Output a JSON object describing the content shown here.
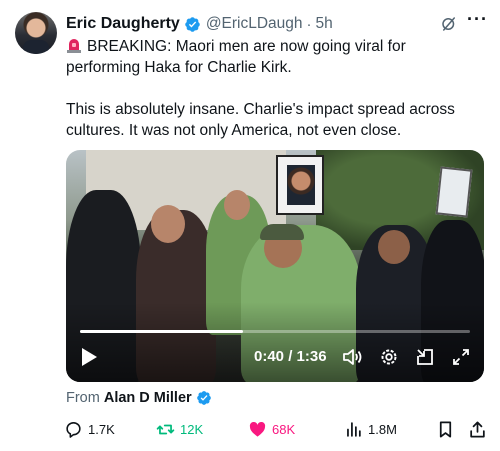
{
  "author": {
    "name": "Eric Daugherty",
    "handle": "@EricLDaugh",
    "separator": "·",
    "time": "5h"
  },
  "tweet": {
    "line1": "BREAKING: Maori men are now going viral for performing Haka for Charlie Kirk.",
    "line2": "This is absolutely insane. Charlie's impact spread across cultures. It was not only America, not even close."
  },
  "video": {
    "timecode": "0:40 / 1:36",
    "progress_fraction": 0.417
  },
  "source": {
    "prefix": "From",
    "name": "Alan D Miller"
  },
  "actions": {
    "replies": "1.7K",
    "reposts": "12K",
    "likes": "68K",
    "views": "1.8M"
  },
  "colors": {
    "verified": "#1d9bf0",
    "repost": "#00ba7c",
    "like": "#f91880",
    "secondary_text": "#536471"
  },
  "icons": [
    "verified-badge-icon",
    "grok-icon",
    "more-icon",
    "siren-icon",
    "play-icon",
    "volume-icon",
    "settings-icon",
    "pip-icon",
    "fullscreen-icon",
    "reply-icon",
    "repost-icon",
    "heart-icon",
    "views-icon",
    "bookmark-icon",
    "share-icon"
  ]
}
